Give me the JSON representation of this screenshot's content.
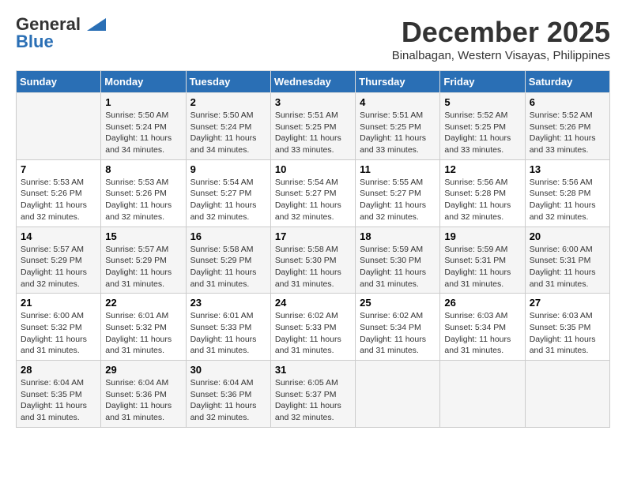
{
  "header": {
    "logo_general": "General",
    "logo_blue": "Blue",
    "month": "December 2025",
    "location": "Binalbagan, Western Visayas, Philippines"
  },
  "days_of_week": [
    "Sunday",
    "Monday",
    "Tuesday",
    "Wednesday",
    "Thursday",
    "Friday",
    "Saturday"
  ],
  "weeks": [
    [
      {
        "day": "",
        "sunrise": "",
        "sunset": "",
        "daylight": ""
      },
      {
        "day": "1",
        "sunrise": "Sunrise: 5:50 AM",
        "sunset": "Sunset: 5:24 PM",
        "daylight": "Daylight: 11 hours and 34 minutes."
      },
      {
        "day": "2",
        "sunrise": "Sunrise: 5:50 AM",
        "sunset": "Sunset: 5:24 PM",
        "daylight": "Daylight: 11 hours and 34 minutes."
      },
      {
        "day": "3",
        "sunrise": "Sunrise: 5:51 AM",
        "sunset": "Sunset: 5:25 PM",
        "daylight": "Daylight: 11 hours and 33 minutes."
      },
      {
        "day": "4",
        "sunrise": "Sunrise: 5:51 AM",
        "sunset": "Sunset: 5:25 PM",
        "daylight": "Daylight: 11 hours and 33 minutes."
      },
      {
        "day": "5",
        "sunrise": "Sunrise: 5:52 AM",
        "sunset": "Sunset: 5:25 PM",
        "daylight": "Daylight: 11 hours and 33 minutes."
      },
      {
        "day": "6",
        "sunrise": "Sunrise: 5:52 AM",
        "sunset": "Sunset: 5:26 PM",
        "daylight": "Daylight: 11 hours and 33 minutes."
      }
    ],
    [
      {
        "day": "7",
        "sunrise": "Sunrise: 5:53 AM",
        "sunset": "Sunset: 5:26 PM",
        "daylight": "Daylight: 11 hours and 32 minutes."
      },
      {
        "day": "8",
        "sunrise": "Sunrise: 5:53 AM",
        "sunset": "Sunset: 5:26 PM",
        "daylight": "Daylight: 11 hours and 32 minutes."
      },
      {
        "day": "9",
        "sunrise": "Sunrise: 5:54 AM",
        "sunset": "Sunset: 5:27 PM",
        "daylight": "Daylight: 11 hours and 32 minutes."
      },
      {
        "day": "10",
        "sunrise": "Sunrise: 5:54 AM",
        "sunset": "Sunset: 5:27 PM",
        "daylight": "Daylight: 11 hours and 32 minutes."
      },
      {
        "day": "11",
        "sunrise": "Sunrise: 5:55 AM",
        "sunset": "Sunset: 5:27 PM",
        "daylight": "Daylight: 11 hours and 32 minutes."
      },
      {
        "day": "12",
        "sunrise": "Sunrise: 5:56 AM",
        "sunset": "Sunset: 5:28 PM",
        "daylight": "Daylight: 11 hours and 32 minutes."
      },
      {
        "day": "13",
        "sunrise": "Sunrise: 5:56 AM",
        "sunset": "Sunset: 5:28 PM",
        "daylight": "Daylight: 11 hours and 32 minutes."
      }
    ],
    [
      {
        "day": "14",
        "sunrise": "Sunrise: 5:57 AM",
        "sunset": "Sunset: 5:29 PM",
        "daylight": "Daylight: 11 hours and 32 minutes."
      },
      {
        "day": "15",
        "sunrise": "Sunrise: 5:57 AM",
        "sunset": "Sunset: 5:29 PM",
        "daylight": "Daylight: 11 hours and 31 minutes."
      },
      {
        "day": "16",
        "sunrise": "Sunrise: 5:58 AM",
        "sunset": "Sunset: 5:29 PM",
        "daylight": "Daylight: 11 hours and 31 minutes."
      },
      {
        "day": "17",
        "sunrise": "Sunrise: 5:58 AM",
        "sunset": "Sunset: 5:30 PM",
        "daylight": "Daylight: 11 hours and 31 minutes."
      },
      {
        "day": "18",
        "sunrise": "Sunrise: 5:59 AM",
        "sunset": "Sunset: 5:30 PM",
        "daylight": "Daylight: 11 hours and 31 minutes."
      },
      {
        "day": "19",
        "sunrise": "Sunrise: 5:59 AM",
        "sunset": "Sunset: 5:31 PM",
        "daylight": "Daylight: 11 hours and 31 minutes."
      },
      {
        "day": "20",
        "sunrise": "Sunrise: 6:00 AM",
        "sunset": "Sunset: 5:31 PM",
        "daylight": "Daylight: 11 hours and 31 minutes."
      }
    ],
    [
      {
        "day": "21",
        "sunrise": "Sunrise: 6:00 AM",
        "sunset": "Sunset: 5:32 PM",
        "daylight": "Daylight: 11 hours and 31 minutes."
      },
      {
        "day": "22",
        "sunrise": "Sunrise: 6:01 AM",
        "sunset": "Sunset: 5:32 PM",
        "daylight": "Daylight: 11 hours and 31 minutes."
      },
      {
        "day": "23",
        "sunrise": "Sunrise: 6:01 AM",
        "sunset": "Sunset: 5:33 PM",
        "daylight": "Daylight: 11 hours and 31 minutes."
      },
      {
        "day": "24",
        "sunrise": "Sunrise: 6:02 AM",
        "sunset": "Sunset: 5:33 PM",
        "daylight": "Daylight: 11 hours and 31 minutes."
      },
      {
        "day": "25",
        "sunrise": "Sunrise: 6:02 AM",
        "sunset": "Sunset: 5:34 PM",
        "daylight": "Daylight: 11 hours and 31 minutes."
      },
      {
        "day": "26",
        "sunrise": "Sunrise: 6:03 AM",
        "sunset": "Sunset: 5:34 PM",
        "daylight": "Daylight: 11 hours and 31 minutes."
      },
      {
        "day": "27",
        "sunrise": "Sunrise: 6:03 AM",
        "sunset": "Sunset: 5:35 PM",
        "daylight": "Daylight: 11 hours and 31 minutes."
      }
    ],
    [
      {
        "day": "28",
        "sunrise": "Sunrise: 6:04 AM",
        "sunset": "Sunset: 5:35 PM",
        "daylight": "Daylight: 11 hours and 31 minutes."
      },
      {
        "day": "29",
        "sunrise": "Sunrise: 6:04 AM",
        "sunset": "Sunset: 5:36 PM",
        "daylight": "Daylight: 11 hours and 31 minutes."
      },
      {
        "day": "30",
        "sunrise": "Sunrise: 6:04 AM",
        "sunset": "Sunset: 5:36 PM",
        "daylight": "Daylight: 11 hours and 32 minutes."
      },
      {
        "day": "31",
        "sunrise": "Sunrise: 6:05 AM",
        "sunset": "Sunset: 5:37 PM",
        "daylight": "Daylight: 11 hours and 32 minutes."
      },
      {
        "day": "",
        "sunrise": "",
        "sunset": "",
        "daylight": ""
      },
      {
        "day": "",
        "sunrise": "",
        "sunset": "",
        "daylight": ""
      },
      {
        "day": "",
        "sunrise": "",
        "sunset": "",
        "daylight": ""
      }
    ]
  ]
}
